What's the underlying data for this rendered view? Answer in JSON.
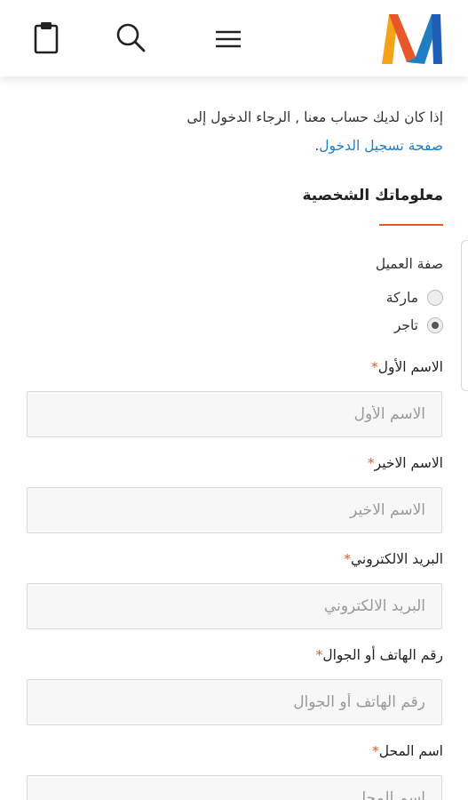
{
  "header": {
    "cart_icon": "clipboard-icon",
    "search_icon": "search-icon",
    "menu_icon": "hamburger-menu-icon",
    "logo_icon": "brand-m-logo",
    "brand_colors": {
      "orange": "#f5a31a",
      "blue": "#1f5fb8",
      "red": "#e8572a"
    }
  },
  "notice": {
    "text": "إذا كان لديك حساب معنا , الرجاء الدخول إلى",
    "link": "صفحة تسجيل الدخول",
    "period": "."
  },
  "section": {
    "title": "معلوماتك الشخصية",
    "accent_color": "#e8572a"
  },
  "customer_type": {
    "label": "صفة العميل",
    "options": [
      {
        "label": "ماركة",
        "checked": false
      },
      {
        "label": "تاجر",
        "checked": true
      }
    ]
  },
  "fields": {
    "first_name": {
      "label": "الاسم الأول",
      "required": "*",
      "placeholder": "الاسم الأول",
      "value": ""
    },
    "last_name": {
      "label": "الاسم الاخير",
      "required": "*",
      "placeholder": "الاسم الاخير",
      "value": ""
    },
    "email": {
      "label": "البريد الالكتروني",
      "required": "*",
      "placeholder": "البريد الالكتروني",
      "value": ""
    },
    "phone": {
      "label": "رقم الهاتف أو الجوال",
      "required": "*",
      "placeholder": "رقم الهاتف أو الجوال",
      "value": ""
    },
    "shop_name": {
      "label": "اسم المحل",
      "required": "*",
      "placeholder": "اسم المحل",
      "value": ""
    }
  }
}
